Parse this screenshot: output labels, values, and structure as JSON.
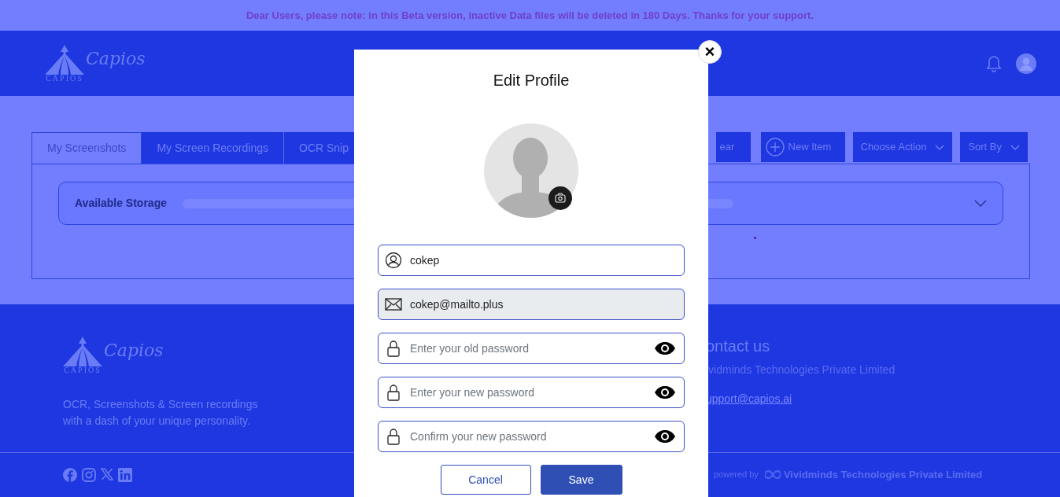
{
  "banner": {
    "text": "Dear Users, please note: in this Beta version, inactive Data files will be deleted in 180 Days. Thanks for your support."
  },
  "header": {
    "logo": {
      "script": "Capios",
      "caption": "CAPIOS"
    }
  },
  "tabs": [
    {
      "label": "My Screenshots",
      "selected": true
    },
    {
      "label": "My Screen Recordings",
      "selected": false
    },
    {
      "label": "OCR Snip",
      "selected": false
    }
  ],
  "toolbar": [
    {
      "label": "ear",
      "kind": "plain"
    },
    {
      "label": "New Item",
      "kind": "add"
    },
    {
      "label": "Choose Action",
      "kind": "dropdown"
    },
    {
      "label": "Sort By",
      "kind": "dropdown"
    }
  ],
  "storage": {
    "label": "Available Storage"
  },
  "footer": {
    "logo": {
      "script": "Capios",
      "caption": "CAPIOS"
    },
    "tagline": "OCR, Screenshots & Screen recordings with a dash of your unique personality.",
    "contact_heading": "ontact us",
    "company": "ividminds Technologies Private Limited",
    "email": "upport@capios.ai",
    "powered_by": "powered by",
    "powered_company": "Vividminds Technologies Private Limited"
  },
  "modal": {
    "title": "Edit Profile",
    "close": "×",
    "fields": [
      {
        "kind": "user",
        "value": "cokep",
        "disabled": false
      },
      {
        "kind": "email",
        "value": "cokep@mailto.plus",
        "disabled": true
      },
      {
        "kind": "password",
        "placeholder": "Enter your old password",
        "disabled": false
      },
      {
        "kind": "password",
        "placeholder": "Enter your new password",
        "disabled": false
      },
      {
        "kind": "password",
        "placeholder": "Confirm your new password",
        "disabled": false
      }
    ],
    "buttons": [
      {
        "label": "Cancel",
        "kind": "outline"
      },
      {
        "label": "Save",
        "kind": "primary"
      }
    ]
  }
}
